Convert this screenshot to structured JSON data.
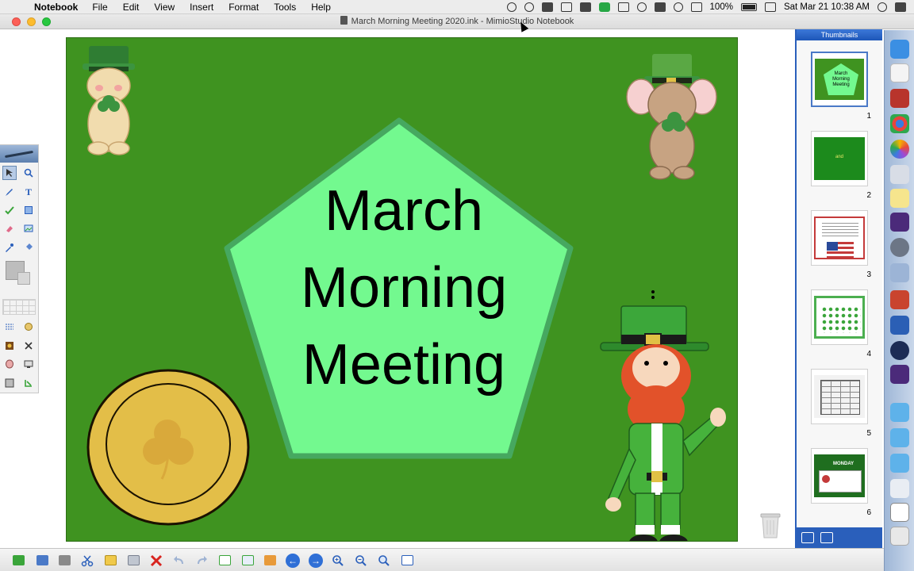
{
  "menubar": {
    "app_name": "Notebook",
    "items": [
      "File",
      "Edit",
      "View",
      "Insert",
      "Format",
      "Tools",
      "Help"
    ],
    "battery": "100%",
    "datetime": "Sat Mar 21  10:38 AM"
  },
  "window": {
    "title": "March Morning Meeting 2020.ink - MimioStudio Notebook"
  },
  "slide": {
    "background_color": "#3f9320",
    "pentagon_color": "#73f98f",
    "title_lines": [
      "March",
      "Morning",
      "Meeting"
    ],
    "images": [
      "bear-with-shamrock",
      "mouse-with-shamrock",
      "gold-coin-with-shamrock",
      "leprechaun"
    ]
  },
  "thumbnails": {
    "header": "Thumbnails",
    "items": [
      {
        "number": "1",
        "label": "March Morning Meeting",
        "selected": true
      },
      {
        "number": "2",
        "label": "and",
        "selected": false
      },
      {
        "number": "3",
        "label": "",
        "selected": false
      },
      {
        "number": "4",
        "label": "",
        "selected": false
      },
      {
        "number": "5",
        "label": "",
        "selected": false
      },
      {
        "number": "6",
        "label": "MONDAY",
        "selected": false
      }
    ]
  },
  "colors": {
    "accent_blue": "#2a5fbb",
    "slide_green": "#3f9320",
    "pentagon_green": "#73f98f"
  }
}
